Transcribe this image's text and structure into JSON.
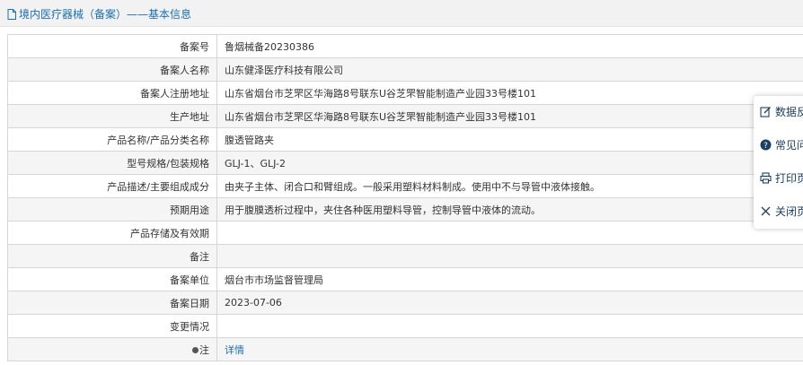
{
  "header": {
    "title": "境内医疗器械（备案）——基本信息"
  },
  "rows": [
    {
      "label": "备案号",
      "value": "鲁烟械备20230386"
    },
    {
      "label": "备案人名称",
      "value": "山东健泽医疗科技有限公司"
    },
    {
      "label": "备案人注册地址",
      "value": "山东省烟台市芝罘区华海路8号联东U谷芝罘智能制造产业园33号楼101"
    },
    {
      "label": "生产地址",
      "value": "山东省烟台市芝罘区华海路8号联东U谷芝罘智能制造产业园33号楼101"
    },
    {
      "label": "产品名称/产品分类名称",
      "value": "腹透管路夹"
    },
    {
      "label": "型号规格/包装规格",
      "value": "GLJ-1、GLJ-2"
    },
    {
      "label": "产品描述/主要组成成分",
      "value": "由夹子主体、闭合口和臂组成。一般采用塑料材料制成。使用中不与导管中液体接触。"
    },
    {
      "label": "预期用途",
      "value": "用于腹膜透析过程中，夹住各种医用塑料导管，控制导管中液体的流动。"
    },
    {
      "label": "产品存储及有效期",
      "value": ""
    },
    {
      "label": "备注",
      "value": ""
    },
    {
      "label": "备案单位",
      "value": "烟台市市场监督管理局"
    },
    {
      "label": "备案日期",
      "value": "2023-07-06"
    },
    {
      "label": "变更情况",
      "value": ""
    }
  ],
  "note_row": {
    "label": "注",
    "link": "详情"
  },
  "float_panel": {
    "items": [
      {
        "label": "数据反",
        "icon": "edit-icon"
      },
      {
        "label": "常见问",
        "icon": "question-icon"
      },
      {
        "label": "打印页",
        "icon": "print-icon"
      },
      {
        "label": "关闭页",
        "icon": "close-icon"
      }
    ]
  }
}
